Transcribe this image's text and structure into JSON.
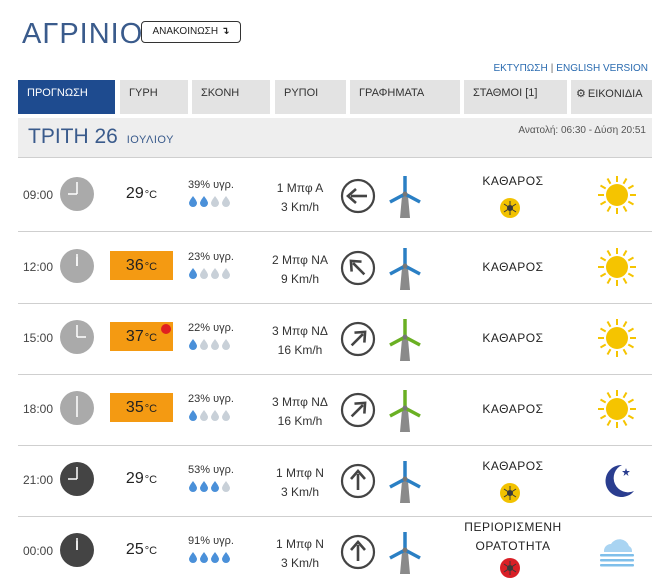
{
  "header": {
    "city": "ΑΓΡΙΝΙΟ",
    "announcements_label": "ΑΝΑΚΟΙΝΩΣΗ",
    "announcements_arrow": "↴",
    "print_link": "ΕΚΤΥΠΩΣΗ",
    "separator": "|",
    "english_link": "ENGLISH VERSION"
  },
  "tabs": [
    {
      "label": "ΠΡΟΓΝΩΣΗ",
      "active": true
    },
    {
      "label": "ΓΥΡΗ"
    },
    {
      "label": "ΣΚΟΝΗ"
    },
    {
      "label": "ΡΥΠΟΙ"
    },
    {
      "label": "ΓΡΑΦΗΜΑΤΑ"
    },
    {
      "label": "ΣΤΑΘΜΟΙ [1]"
    },
    {
      "label": "ΕΙΚΟΝΙΔΙΑ",
      "icon": "gear-icon"
    }
  ],
  "day": {
    "name": "ΤΡΙΤΗ 26",
    "month": "ΙΟΥΛΙΟΥ",
    "sun": "Ανατολή: 06:30 - Δύση 20:51"
  },
  "units": {
    "deg": "°C"
  },
  "colors": {
    "brand": "#1e4b8f",
    "title": "#3a5b8c",
    "hot": "#f49a12",
    "sun": "#f5c400",
    "moon": "#2a3d8f",
    "drop": "#4a90d9",
    "drop_empty": "#c8d0d8",
    "turbine_blue": "#2a7fc4",
    "turbine_green": "#6ab023",
    "dust_ok": "#f2c200",
    "dust_bad": "#d91f26"
  },
  "rows": [
    {
      "time": "09:00",
      "clock_hour": 9,
      "night": false,
      "temp": "29",
      "hot": false,
      "max_dot": false,
      "humidity": "39% υγρ.",
      "drops": 2,
      "wind_bft": "1 Μπφ Α",
      "wind_kmh": "3 Km/h",
      "arrow_deg": 270,
      "turbine": "blue",
      "condition": [
        "ΚΑΘΑΡΟΣ"
      ],
      "dust": "ok",
      "weather_icon": "sun-icon"
    },
    {
      "time": "12:00",
      "clock_hour": 12,
      "night": false,
      "temp": "36",
      "hot": true,
      "max_dot": false,
      "humidity": "23% υγρ.",
      "drops": 1,
      "wind_bft": "2 Μπφ ΝΑ",
      "wind_kmh": "9 Km/h",
      "arrow_deg": 315,
      "turbine": "blue",
      "condition": [
        "ΚΑΘΑΡΟΣ"
      ],
      "dust": "none",
      "weather_icon": "sun-icon"
    },
    {
      "time": "15:00",
      "clock_hour": 15,
      "night": false,
      "temp": "37",
      "hot": true,
      "max_dot": true,
      "humidity": "22% υγρ.",
      "drops": 1,
      "wind_bft": "3 Μπφ ΝΔ",
      "wind_kmh": "16 Km/h",
      "arrow_deg": 45,
      "turbine": "green",
      "condition": [
        "ΚΑΘΑΡΟΣ"
      ],
      "dust": "none",
      "weather_icon": "sun-icon"
    },
    {
      "time": "18:00",
      "clock_hour": 18,
      "night": false,
      "temp": "35",
      "hot": true,
      "max_dot": false,
      "humidity": "23% υγρ.",
      "drops": 1,
      "wind_bft": "3 Μπφ ΝΔ",
      "wind_kmh": "16 Km/h",
      "arrow_deg": 45,
      "turbine": "green",
      "condition": [
        "ΚΑΘΑΡΟΣ"
      ],
      "dust": "none",
      "weather_icon": "sun-icon"
    },
    {
      "time": "21:00",
      "clock_hour": 21,
      "night": true,
      "temp": "29",
      "hot": false,
      "max_dot": false,
      "humidity": "53% υγρ.",
      "drops": 3,
      "wind_bft": "1 Μπφ Ν",
      "wind_kmh": "3 Km/h",
      "arrow_deg": 0,
      "turbine": "blue",
      "condition": [
        "ΚΑΘΑΡΟΣ"
      ],
      "dust": "ok",
      "weather_icon": "moon-icon"
    },
    {
      "time": "00:00",
      "clock_hour": 0,
      "night": true,
      "temp": "25",
      "hot": false,
      "max_dot": false,
      "humidity": "91% υγρ.",
      "drops": 4,
      "wind_bft": "1 Μπφ Ν",
      "wind_kmh": "3 Km/h",
      "arrow_deg": 0,
      "turbine": "blue",
      "condition": [
        "ΠΕΡΙΟΡΙΣΜΕΝΗ",
        "ΟΡΑΤΟΤΗΤΑ"
      ],
      "dust": "bad",
      "weather_icon": "fog-icon"
    }
  ]
}
